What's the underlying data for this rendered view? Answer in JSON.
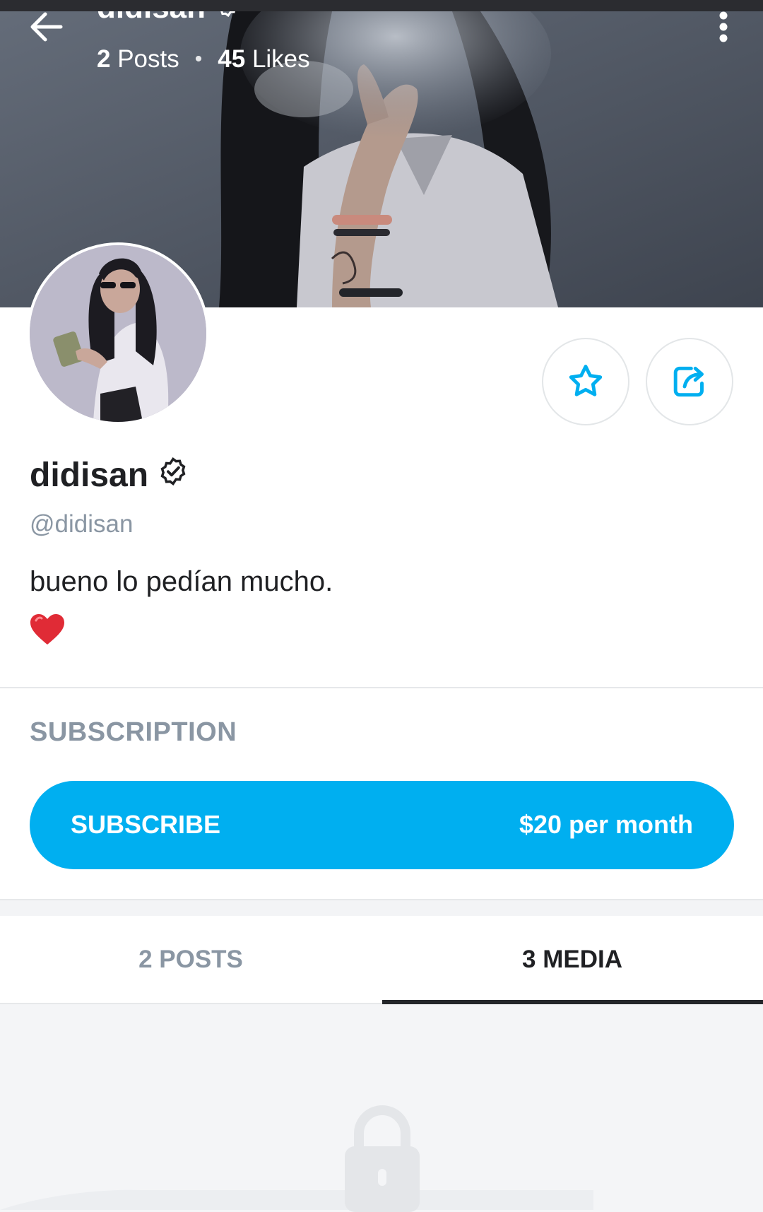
{
  "header": {
    "name": "didisan",
    "posts_count": "2",
    "posts_label": "Posts",
    "separator": "•",
    "likes_count": "45",
    "likes_label": "Likes"
  },
  "profile": {
    "display_name": "didisan",
    "handle": "@didisan",
    "bio": "bueno lo pedían mucho.",
    "bio_emoji": "red-heart"
  },
  "subscription": {
    "heading": "SUBSCRIPTION",
    "button_label": "SUBSCRIBE",
    "price": "$20 per month"
  },
  "tabs": [
    {
      "label": "2 POSTS",
      "active": false
    },
    {
      "label": "3 MEDIA",
      "active": true
    }
  ],
  "icons": {
    "back": "arrow-left-icon",
    "more": "more-vertical-icon",
    "verified": "verified-badge-icon",
    "favorite": "star-icon",
    "share": "share-icon",
    "locked": "lock-icon"
  },
  "colors": {
    "accent": "#00aff0",
    "text_primary": "#1f2023",
    "text_muted": "#8a96a3",
    "divider": "#e6e8ea"
  }
}
